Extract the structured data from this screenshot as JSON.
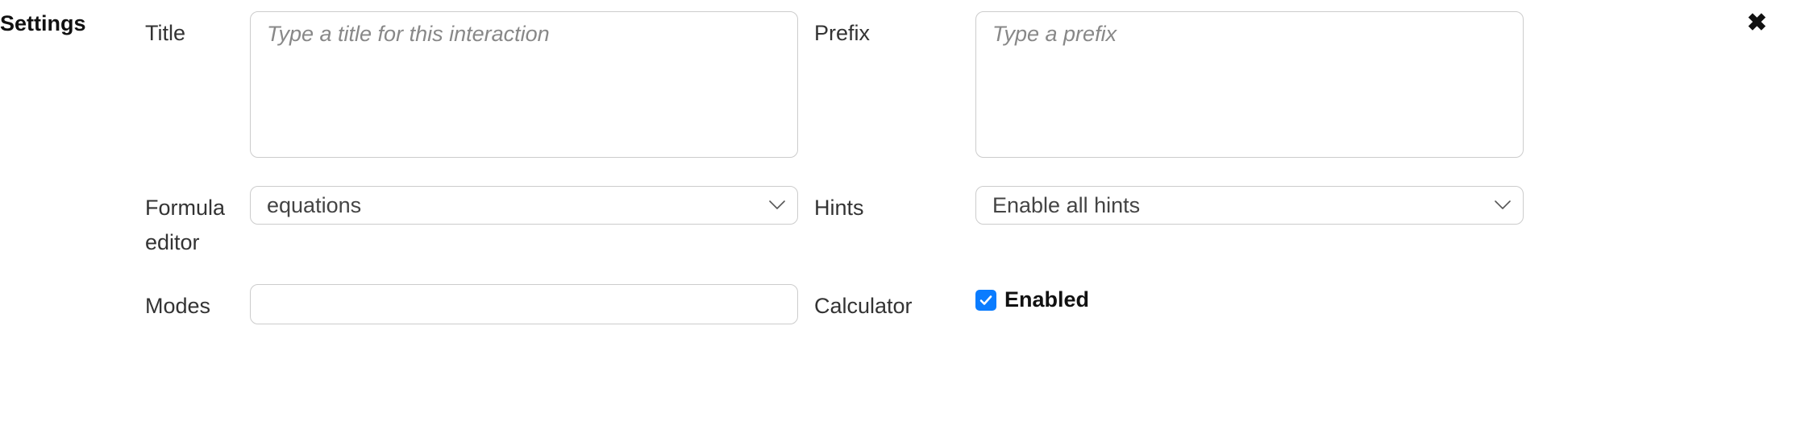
{
  "section": {
    "heading": "Settings"
  },
  "title": {
    "label": "Title",
    "value": "",
    "placeholder": "Type a title for this interaction"
  },
  "prefix": {
    "label": "Prefix",
    "value": "",
    "placeholder": "Type a prefix"
  },
  "formulaEditor": {
    "label": "Formula editor",
    "value": "equations"
  },
  "hints": {
    "label": "Hints",
    "value": "Enable all hints"
  },
  "modes": {
    "label": "Modes",
    "value": ""
  },
  "calculator": {
    "label": "Calculator",
    "checkLabel": "Enabled",
    "checked": true
  },
  "close": {
    "glyph": "✖"
  }
}
